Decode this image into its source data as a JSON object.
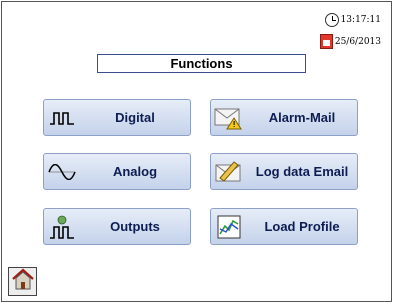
{
  "status": {
    "time": "13:17:11",
    "date": "25/6/2013"
  },
  "header": {
    "title": "Functions"
  },
  "buttons": {
    "digital": {
      "label": "Digital",
      "icon": "pulse-wave-icon"
    },
    "analog": {
      "label": "Analog",
      "icon": "sine-wave-icon"
    },
    "outputs": {
      "label": "Outputs",
      "icon": "output-pulse-icon"
    },
    "alarm_mail": {
      "label": "Alarm-Mail",
      "icon": "mail-warning-icon"
    },
    "log_email": {
      "label": "Log data Email",
      "icon": "mail-pencil-icon"
    },
    "load_profile": {
      "label": "Load Profile",
      "icon": "chart-icon"
    }
  },
  "footer": {
    "home_icon": "home-icon"
  },
  "colors": {
    "button_text": "#0d1d52",
    "button_border": "#8da0c8",
    "accent_red": "#e2372b"
  }
}
